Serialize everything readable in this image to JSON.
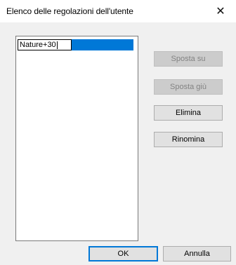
{
  "window": {
    "title": "Elenco delle regolazioni dell'utente",
    "close_glyph": "✕"
  },
  "list": {
    "edit_value": "Nature+30"
  },
  "buttons": {
    "move_up": "Sposta su",
    "move_down": "Sposta giù",
    "delete": "Elimina",
    "rename": "Rinomina",
    "ok": "OK",
    "cancel": "Annulla"
  },
  "colors": {
    "selection": "#0078d7",
    "dialog_bg": "#f0f0f0",
    "button_bg": "#e1e1e1",
    "disabled_text": "#838383"
  }
}
